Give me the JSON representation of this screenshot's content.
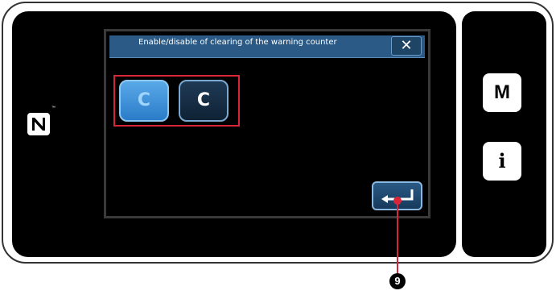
{
  "dialog": {
    "title": "Enable/disable of clearing of the warning counter",
    "close_label": "✕"
  },
  "buttons": {
    "enabled_label": "C",
    "disabled_label": "C"
  },
  "side": {
    "m_label": "M",
    "i_label": "i"
  },
  "callout": {
    "number": "9"
  },
  "colors": {
    "title_bar": "#2a5a85",
    "highlight": "#d8253a",
    "button_active": "#3d93db"
  }
}
